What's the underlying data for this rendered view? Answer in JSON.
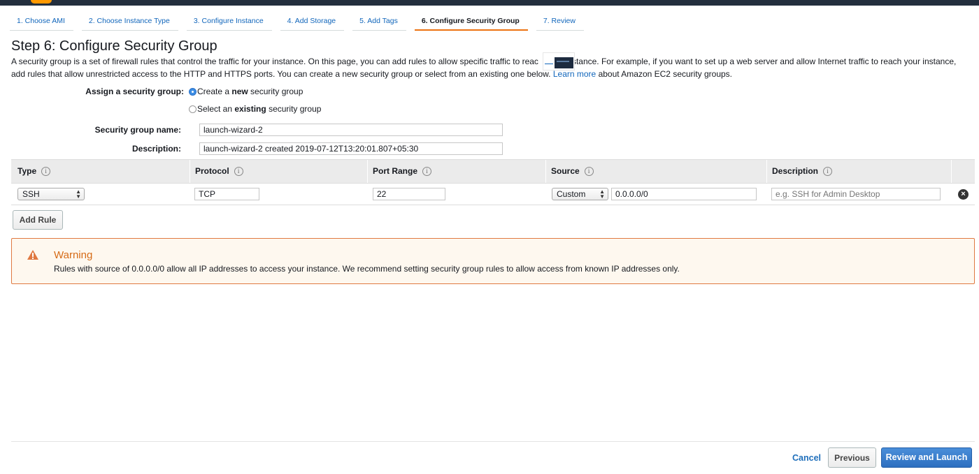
{
  "wizard_tabs": [
    {
      "label": "1. Choose AMI"
    },
    {
      "label": "2. Choose Instance Type"
    },
    {
      "label": "3. Configure Instance"
    },
    {
      "label": "4. Add Storage"
    },
    {
      "label": "5. Add Tags"
    },
    {
      "label": "6. Configure Security Group",
      "active": true
    },
    {
      "label": "7. Review"
    }
  ],
  "page": {
    "title": "Step 6: Configure Security Group",
    "intro_part1": "A security group is a set of firewall rules that control the traffic for your instance. On this page, you can add rules to allow specific traffic to reac",
    "intro_part2": "stance. For example, if you want to set up a web server and allow Internet traffic to reach your instance, add rules that allow unrestricted access to the HTTP and HTTPS ports. You can create a new security group or select from an existing one below.",
    "learn_more": "Learn more",
    "intro_tail": "about Amazon EC2 security groups."
  },
  "assign": {
    "label": "Assign a security group:",
    "option_new_pre": "Create a ",
    "option_new_bold": "new",
    "option_new_post": " security group",
    "option_existing_pre": "Select an ",
    "option_existing_bold": "existing",
    "option_existing_post": " security group",
    "selected": "new"
  },
  "group_form": {
    "name_label": "Security group name:",
    "name_value": "launch-wizard-2",
    "description_label": "Description:",
    "description_value": "launch-wizard-2 created 2019-07-12T13:20:01.807+05:30"
  },
  "rules_table": {
    "columns": [
      "Type",
      "Protocol",
      "Port Range",
      "Source",
      "Description"
    ],
    "rows": [
      {
        "type": "SSH",
        "protocol": "TCP",
        "port_range": "22",
        "source_mode": "Custom",
        "source_cidr": "0.0.0.0/0",
        "description_placeholder": "e.g. SSH for Admin Desktop"
      }
    ]
  },
  "add_rule_label": "Add Rule",
  "warning": {
    "title": "Warning",
    "text": "Rules with source of 0.0.0.0/0 allow all IP addresses to access your instance. We recommend setting security group rules to allow access from known IP addresses only.",
    "color": "#d66b17"
  },
  "footer": {
    "cancel": "Cancel",
    "previous": "Previous",
    "review_launch": "Review and Launch"
  },
  "colors": {
    "link": "#1166bb",
    "primary": "#2d6fc0",
    "active_tab_underline": "#ec7211",
    "topbar": "#232f3e"
  }
}
